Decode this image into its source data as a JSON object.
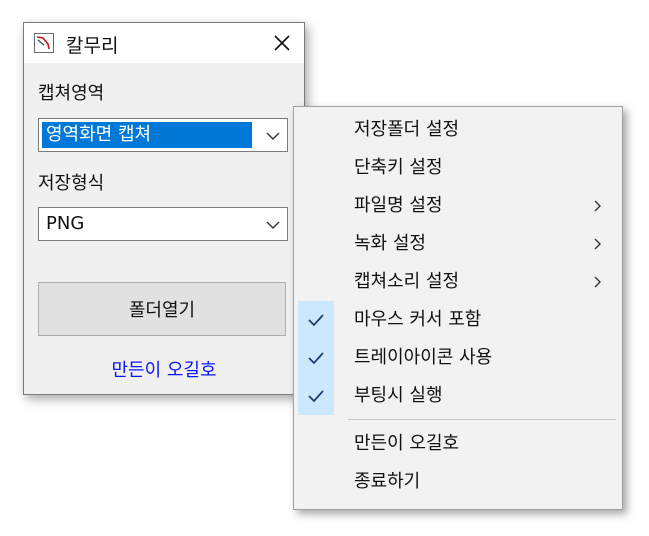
{
  "window": {
    "title": "칼무리",
    "capture_area": {
      "label": "캡쳐영역",
      "selected": "영역화면 캡쳐"
    },
    "save_format": {
      "label": "저장형식",
      "selected": "PNG"
    },
    "open_folder_button": "폴더열기",
    "author_link": "만든이 오길호"
  },
  "context_menu": {
    "items": [
      {
        "label": "저장폴더 설정",
        "checked": false,
        "submenu": false
      },
      {
        "label": "단축키 설정",
        "checked": false,
        "submenu": false
      },
      {
        "label": "파일명 설정",
        "checked": false,
        "submenu": true
      },
      {
        "label": "녹화 설정",
        "checked": false,
        "submenu": true
      },
      {
        "label": "캡쳐소리 설정",
        "checked": false,
        "submenu": true
      },
      {
        "label": "마우스 커서 포함",
        "checked": true,
        "submenu": false
      },
      {
        "label": "트레이아이콘 사용",
        "checked": true,
        "submenu": false
      },
      {
        "label": "부팅시 실행",
        "checked": true,
        "submenu": false
      },
      {
        "label": "만든이 오길호",
        "checked": false,
        "submenu": false
      },
      {
        "label": "종료하기",
        "checked": false,
        "submenu": false
      }
    ]
  },
  "icons": {
    "app": "brush-app-icon",
    "close": "close-icon",
    "dropdown": "chevron-down-icon",
    "submenu": "chevron-right-icon",
    "check": "check-icon"
  },
  "colors": {
    "selection": "#0078d7",
    "check_highlight": "#cce8ff",
    "link": "#0a14ff"
  }
}
